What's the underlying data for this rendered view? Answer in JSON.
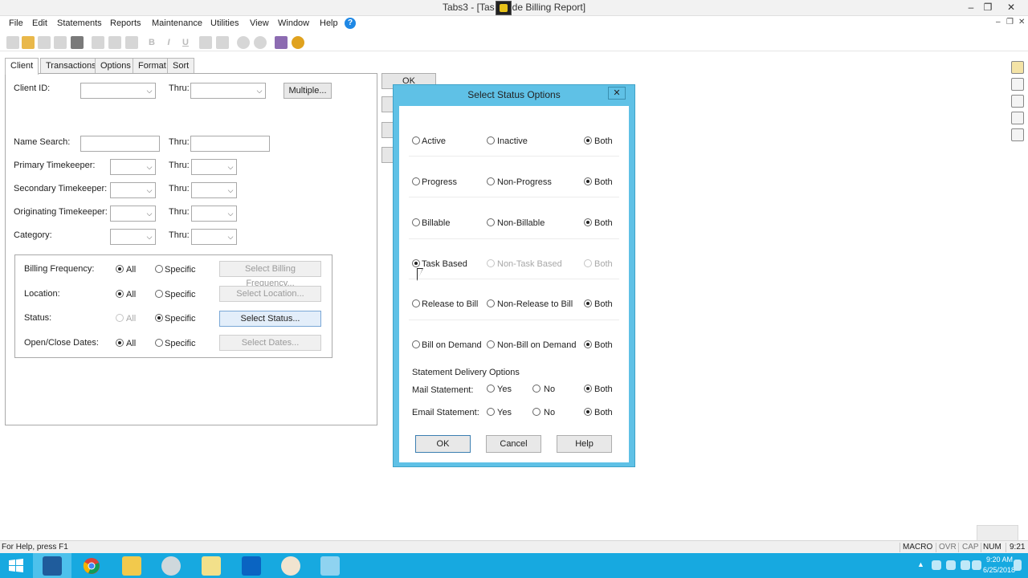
{
  "window": {
    "title": "Tabs3 - [Tas   de Billing Report]",
    "title_text_left": "Tabs3 - [Tas",
    "title_text_right": "de Billing Report]",
    "minimize_label": "–",
    "restore_label": "❐",
    "close_label": "✕"
  },
  "menu": {
    "items": [
      "File",
      "Edit",
      "Statements",
      "Reports",
      "Maintenance",
      "Utilities",
      "View",
      "Window",
      "Help"
    ],
    "help_icon_glyph": "?",
    "mdi_minimize": "–",
    "mdi_restore": "❐",
    "mdi_close": "✕"
  },
  "tabs": [
    {
      "label": "Client",
      "active": true
    },
    {
      "label": "Transactions",
      "active": false
    },
    {
      "label": "Options",
      "active": false
    },
    {
      "label": "Format",
      "active": false
    },
    {
      "label": "Sort",
      "active": false
    }
  ],
  "client_tab": {
    "client_id_label": "Client ID:",
    "thru_label": "Thru:",
    "multiple_button": "Multiple...",
    "name_search_label": "Name Search:",
    "primary_tk_label": "Primary Timekeeper:",
    "secondary_tk_label": "Secondary Timekeeper:",
    "originating_tk_label": "Originating Timekeeper:",
    "category_label": "Category:",
    "group": {
      "billing_frequency_label": "Billing Frequency:",
      "location_label": "Location:",
      "status_label": "Status:",
      "open_close_label": "Open/Close Dates:",
      "all_label": "All",
      "specific_label": "Specific",
      "select_billing_frequency": "Select Billing Frequency...",
      "select_location": "Select Location...",
      "select_status": "Select Status...",
      "select_dates": "Select Dates..."
    }
  },
  "side_ok_label": "OK",
  "dialog": {
    "title": "Select Status Options",
    "close_glyph": "✕",
    "rows": [
      {
        "a": "Active",
        "b": "Inactive",
        "c": "Both",
        "selected": "c",
        "disabled": false
      },
      {
        "a": "Progress",
        "b": "Non-Progress",
        "c": "Both",
        "selected": "c",
        "disabled": false
      },
      {
        "a": "Billable",
        "b": "Non-Billable",
        "c": "Both",
        "selected": "c",
        "disabled": false
      },
      {
        "a": "Task Based",
        "b": "Non-Task Based",
        "c": "Both",
        "selected": "a",
        "disabled": true
      },
      {
        "a": "Release to Bill",
        "b": "Non-Release to Bill",
        "c": "Both",
        "selected": "c",
        "disabled": false
      },
      {
        "a": "Bill on Demand",
        "b": "Non-Bill on Demand",
        "c": "Both",
        "selected": "c",
        "disabled": false
      }
    ],
    "delivery_header": "Statement Delivery Options",
    "mail_label": "Mail Statement:",
    "email_label": "Email Statement:",
    "yes_label": "Yes",
    "no_label": "No",
    "both_label": "Both",
    "ok_button": "OK",
    "cancel_button": "Cancel",
    "help_button": "Help"
  },
  "statusbar": {
    "help_text": "For Help, press F1",
    "macro": "MACRO",
    "ovr": "OVR",
    "cap": "CAP",
    "num": "NUM",
    "time": "9:21"
  },
  "taskbar": {
    "clock_time": "9:20 AM",
    "clock_date": "6/25/2018"
  }
}
